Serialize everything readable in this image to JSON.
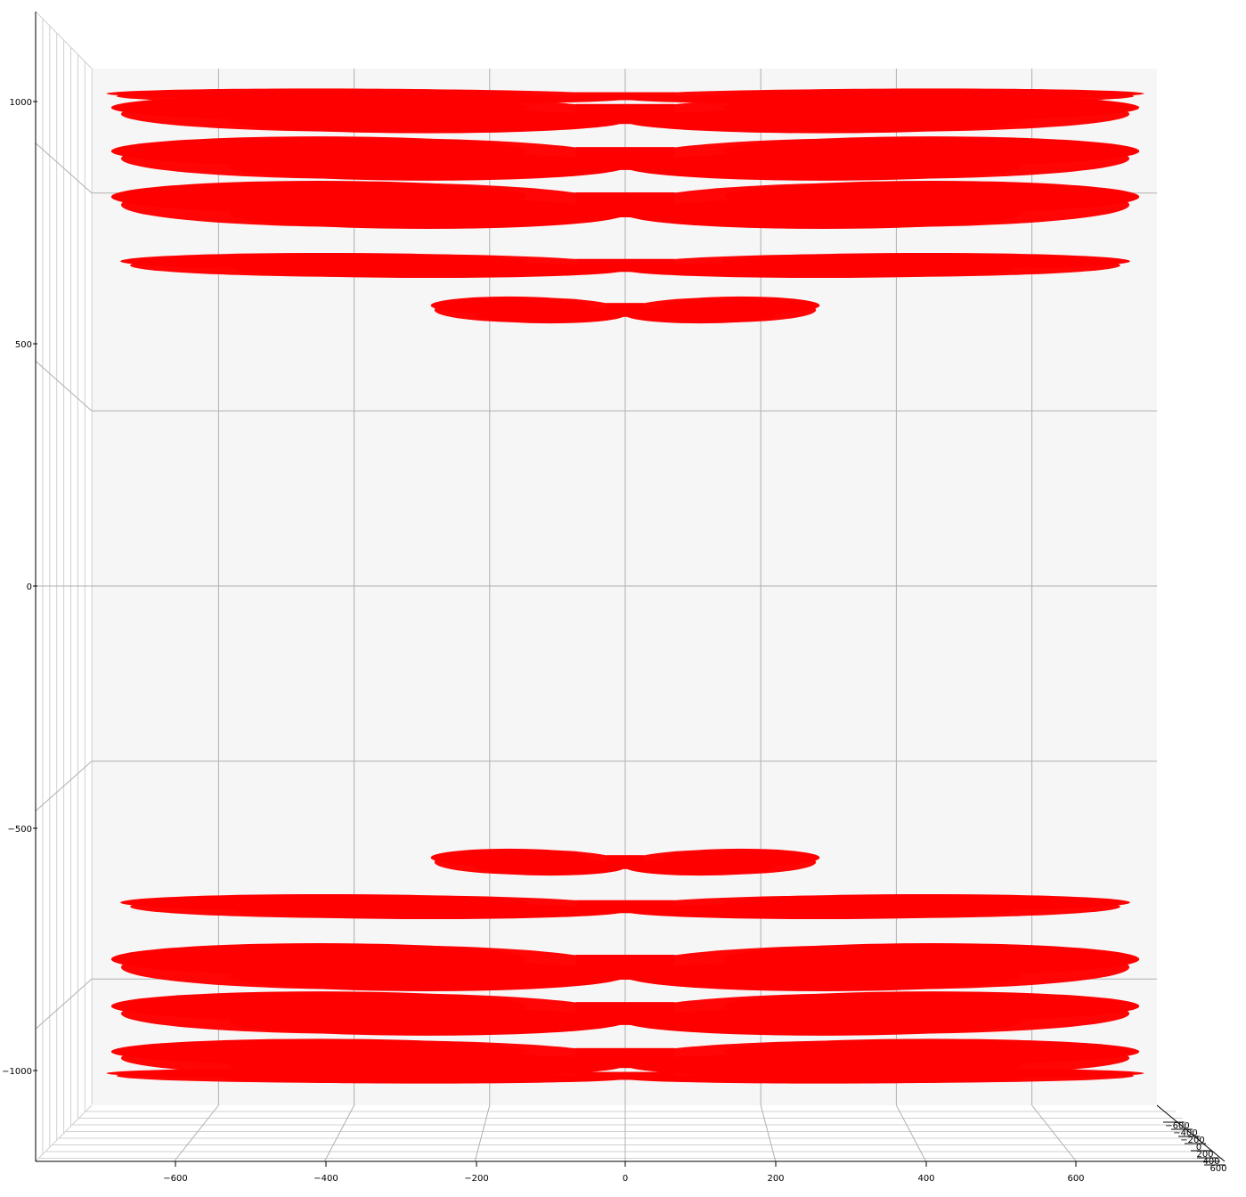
{
  "chart_data": {
    "type": "scatter",
    "projection": "3d",
    "title": "",
    "xlabel": "",
    "ylabel": "",
    "zlabel": "",
    "grid": true,
    "marker_color": "#ff0000",
    "pane_color": "#f6f6f6",
    "x_ticks": [
      "−600",
      "−400",
      "−200",
      "0",
      "200",
      "400",
      "600"
    ],
    "y_ticks": [
      "−600",
      "−400",
      "−200",
      "0",
      "200",
      "400",
      "600"
    ],
    "z_ticks": [
      "1000",
      "500",
      "0",
      "−500",
      "−1000"
    ],
    "xlim": [
      -790,
      790
    ],
    "ylim": [
      -700,
      700
    ],
    "zlim": [
      -1200,
      1200
    ],
    "symmetry": "mirror about z = 0 and x = 0",
    "bands_upper": [
      {
        "z": 1015,
        "x_half_width": 560,
        "thickness": 28
      },
      {
        "z": 990,
        "x_half_width": 650,
        "thickness": 45
      },
      {
        "z": 895,
        "x_half_width": 650,
        "thickness": 60
      },
      {
        "z": 790,
        "x_half_width": 650,
        "thickness": 65
      },
      {
        "z": 680,
        "x_half_width": 640,
        "thickness": 35
      },
      {
        "z": 575,
        "x_half_width": 250,
        "thickness": 40
      }
    ]
  }
}
